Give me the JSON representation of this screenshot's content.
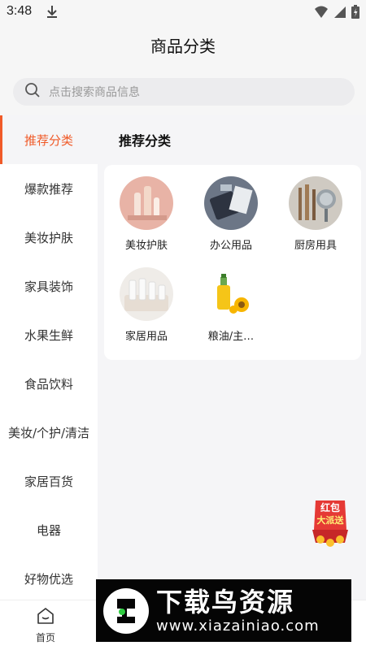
{
  "status": {
    "time": "3:48"
  },
  "header": {
    "title": "商品分类"
  },
  "search": {
    "placeholder": "点击搜索商品信息"
  },
  "sidebar": {
    "items": [
      {
        "label": "推荐分类",
        "active": true
      },
      {
        "label": "爆款推荐"
      },
      {
        "label": "美妆护肤"
      },
      {
        "label": "家具装饰"
      },
      {
        "label": "水果生鲜"
      },
      {
        "label": "食品饮料"
      },
      {
        "label": "美妆/个护/清洁"
      },
      {
        "label": "家居百货"
      },
      {
        "label": "电器"
      },
      {
        "label": "好物优选"
      }
    ]
  },
  "content": {
    "section_title": "推荐分类",
    "categories": [
      {
        "label": "美妆护肤",
        "icon": "cosmetics-image"
      },
      {
        "label": "办公用品",
        "icon": "office-supplies-image"
      },
      {
        "label": "厨房用具",
        "icon": "kitchenware-image"
      },
      {
        "label": "家居用品",
        "icon": "household-image"
      },
      {
        "label": "粮油/主…",
        "icon": "grain-oil-image"
      }
    ]
  },
  "promo": {
    "line1": "红包",
    "line2": "大派送"
  },
  "tabbar": {
    "items": [
      {
        "label": "首页",
        "icon": "home-icon"
      }
    ]
  },
  "watermark": {
    "brand": "下载鸟资源",
    "url": "www.xiazainiao.com"
  },
  "colors": {
    "accent": "#f05a28",
    "background": "#f5f5f7"
  }
}
